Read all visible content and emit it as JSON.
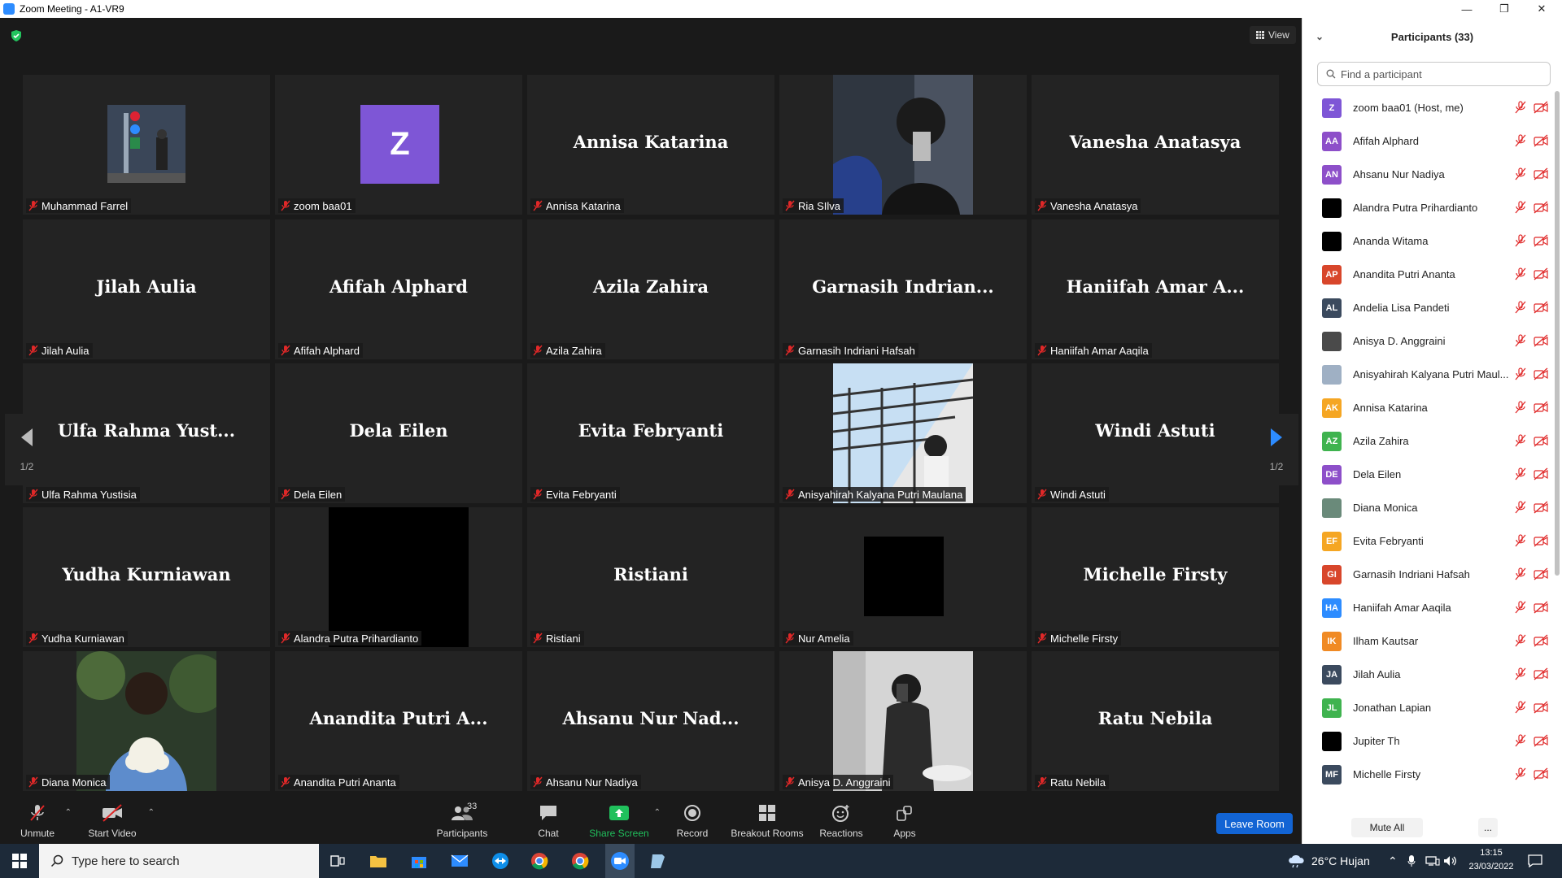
{
  "window": {
    "title": "Zoom Meeting - A1-VR9"
  },
  "view_button": {
    "label": "View"
  },
  "pager": {
    "left": "1/2",
    "right": "1/2"
  },
  "tiles": [
    {
      "big": "",
      "label": "Muhammad Farrel"
    },
    {
      "big": "",
      "label": "zoom baa01",
      "avatar": "Z"
    },
    {
      "big": "Annisa Katarina",
      "label": "Annisa Katarina"
    },
    {
      "big": "",
      "label": "Ria SIlva"
    },
    {
      "big": "Vanesha Anatasya",
      "label": "Vanesha Anatasya"
    },
    {
      "big": "Jilah Aulia",
      "label": "Jilah Aulia"
    },
    {
      "big": "Afifah Alphard",
      "label": "Afifah Alphard"
    },
    {
      "big": "Azila Zahira",
      "label": "Azila Zahira"
    },
    {
      "big": "Garnasih Indrian...",
      "label": "Garnasih Indriani Hafsah"
    },
    {
      "big": "Haniifah Amar A...",
      "label": "Haniifah Amar Aaqila"
    },
    {
      "big": "Ulfa Rahma Yust...",
      "label": "Ulfa Rahma Yustisia"
    },
    {
      "big": "Dela Eilen",
      "label": "Dela Eilen"
    },
    {
      "big": "Evita Febryanti",
      "label": "Evita Febryanti"
    },
    {
      "big": "",
      "label": "Anisyahirah Kalyana Putri Maulana"
    },
    {
      "big": "Windi Astuti",
      "label": "Windi Astuti"
    },
    {
      "big": "Yudha Kurniawan",
      "label": "Yudha Kurniawan"
    },
    {
      "big": "",
      "label": "Alandra Putra Prihardianto"
    },
    {
      "big": "Ristiani",
      "label": "Ristiani"
    },
    {
      "big": "",
      "label": "Nur Amelia"
    },
    {
      "big": "Michelle Firsty",
      "label": "Michelle Firsty"
    },
    {
      "big": "",
      "label": "Diana Monica"
    },
    {
      "big": "Anandita Putri A...",
      "label": "Anandita Putri Ananta"
    },
    {
      "big": "Ahsanu Nur Nad...",
      "label": "Ahsanu Nur Nadiya"
    },
    {
      "big": "",
      "label": "Anisya D. Anggraini"
    },
    {
      "big": "Ratu Nebila",
      "label": "Ratu Nebila"
    }
  ],
  "toolbar": {
    "unmute": "Unmute",
    "start_video": "Start Video",
    "participants": "Participants",
    "participants_count": "33",
    "chat": "Chat",
    "share_screen": "Share Screen",
    "record": "Record",
    "breakout_rooms": "Breakout Rooms",
    "reactions": "Reactions",
    "apps": "Apps",
    "leave_room": "Leave Room"
  },
  "panel": {
    "title": "Participants (33)",
    "search_placeholder": "Find a participant",
    "mute_all": "Mute All",
    "more": "...",
    "participants": [
      {
        "initials": "Z",
        "name": "zoom baa01 (Host, me)",
        "color": "#7e56d6"
      },
      {
        "initials": "AA",
        "name": "Afifah Alphard",
        "color": "#8d4fc9"
      },
      {
        "initials": "AN",
        "name": "Ahsanu Nur Nadiya",
        "color": "#8d4fc9"
      },
      {
        "initials": "",
        "name": "Alandra Putra Prihardianto",
        "color": "#000000"
      },
      {
        "initials": "",
        "name": "Ananda Witama",
        "color": "#000000"
      },
      {
        "initials": "AP",
        "name": "Anandita Putri Ananta",
        "color": "#d8462b"
      },
      {
        "initials": "AL",
        "name": "Andelia Lisa Pandeti",
        "color": "#3b4a5e"
      },
      {
        "initials": "",
        "name": "Anisya D. Anggraini",
        "color": "#4a4a4a"
      },
      {
        "initials": "",
        "name": "Anisyahirah Kalyana Putri Maul...",
        "color": "#9fb0c4"
      },
      {
        "initials": "AK",
        "name": "Annisa Katarina",
        "color": "#f5a623"
      },
      {
        "initials": "AZ",
        "name": "Azila Zahira",
        "color": "#3fb34f"
      },
      {
        "initials": "DE",
        "name": "Dela Eilen",
        "color": "#8d4fc9"
      },
      {
        "initials": "",
        "name": "Diana Monica",
        "color": "#6a8a7a"
      },
      {
        "initials": "EF",
        "name": "Evita Febryanti",
        "color": "#f5a623"
      },
      {
        "initials": "GI",
        "name": "Garnasih Indriani Hafsah",
        "color": "#d8462b"
      },
      {
        "initials": "HA",
        "name": "Haniifah Amar Aaqila",
        "color": "#2d8cff"
      },
      {
        "initials": "IK",
        "name": "Ilham Kautsar",
        "color": "#f08a24"
      },
      {
        "initials": "JA",
        "name": "Jilah Aulia",
        "color": "#3b4a5e"
      },
      {
        "initials": "JL",
        "name": "Jonathan Lapian",
        "color": "#3fb34f"
      },
      {
        "initials": "",
        "name": "Jupiter Th",
        "color": "#000000"
      },
      {
        "initials": "MF",
        "name": "Michelle Firsty",
        "color": "#3b4a5e"
      }
    ]
  },
  "taskbar": {
    "search_placeholder": "Type here to search",
    "weather": "26°C  Hujan",
    "time": "13:15",
    "date": "23/03/2022"
  },
  "colors": {
    "accent_blue": "#2d8cff",
    "leave_button": "#1264d4",
    "muted_red": "#e02828",
    "share_green": "#20c05c"
  }
}
